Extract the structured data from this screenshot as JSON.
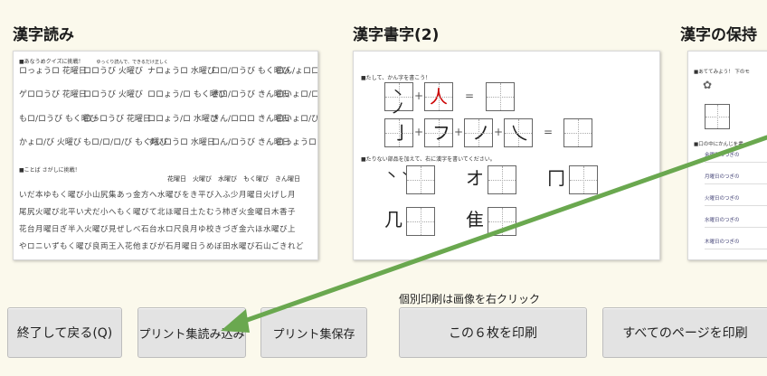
{
  "panels": {
    "reading": {
      "title": "漢字読み",
      "instr1": "■あなうめクイズに挑戦！",
      "instr1_note": "ゆっくり読んで、できるだけ正しく",
      "drill": [
        [
          "ロっょうロ 花曜日",
          "ロロうび 火曜び",
          "ナロょうロ 水曜び",
          "ロロ/ロうび もく曜び",
          "ロん/ょロロ きん曜日"
        ],
        [
          "ゲロロうび 花曜日",
          "ロロうび 火曜び",
          "ロロょう/ロ もく曜び",
          "きロ/ロうび きん曜日",
          "ロいょロ/ロ 水曜び"
        ],
        [
          "もロ/ロうび もく曜び",
          "ロっロうび 花曜日",
          "ロロょう/ロ 水曜び",
          "きん/ロロロ きん曜日",
          "ロいょロ/び 水曜び"
        ],
        [
          "かょロ/び 火曜び",
          "もロ/ロ/ロ/び もく曜び",
          "すいロうロ 水曜日",
          "ロん/ロうび きん曜日",
          "ロっょうロ 花曜日"
        ]
      ],
      "instr2": "■ことば さがしに挑戦！",
      "instr2_words": "花曜日　火曜び　水曜び　もく曜び　きん曜日",
      "prose": [
        "いだ本ゆもく曜び小山尻集あっ金方へ水曜びをき平び入ふ少月曜日火げし月",
        "尾尻火曜び北平い犬だ小へもく曜びて北ほ曜日土たむう柿ぎ火金曜日木香子",
        "花台月曜日ぎ半入火曜び見ぜしべ石台水ロ尺良月ゆ校きづぎ金六ほ水曜び上",
        "やロニいずもく曜び良両王入花他まびが石月曜日うめぼ田水曜び石山ごきれど"
      ]
    },
    "writing": {
      "title": "漢字書字(2)",
      "instr1": "■たして、かん字を書こう！",
      "instr2": "■たりない部品を加えて、右に漢字を書いてください。",
      "row1": [
        "丶ノ",
        "人",
        "="
      ],
      "row2": [
        "亅",
        "フ",
        "ノ",
        "乀",
        "="
      ],
      "parts": [
        "丶丶",
        "オ",
        "冂",
        "几",
        "隹"
      ]
    },
    "keeping": {
      "title": "漢字の保持",
      "instr1": "■あててみよう！ 下のモ",
      "instr2": "■口の中にかんじを書",
      "lines": [
        "金曜日のつぎの",
        "月曜日のつぎの",
        "火曜日のつぎの",
        "水曜日のつぎの",
        "木曜日のつぎの"
      ]
    }
  },
  "note": "個別印刷は画像を右クリック",
  "buttons": {
    "exit": "終了して戻る(Q)",
    "load": "プリント集読み込み",
    "save": "プリント集保存",
    "print6": "この６枚を印刷",
    "print_all": "すべてのページを印刷"
  },
  "colors": {
    "arrow": "#6aa84f",
    "background": "#fbf9ec",
    "button": "#e3e3e3"
  }
}
